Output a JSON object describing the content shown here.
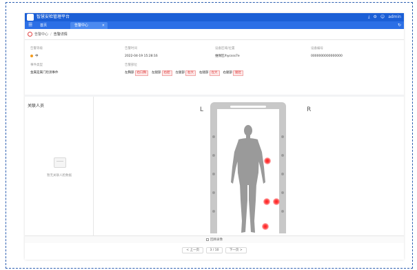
{
  "app": {
    "title": "智慧安检管理平台",
    "user": "admin"
  },
  "topbar": {
    "icons": [
      "download-icon",
      "settings-icon",
      "user-icon"
    ]
  },
  "tabs": [
    {
      "label": "首页"
    },
    {
      "label": "告警中心"
    }
  ],
  "breadcrumb": {
    "parent": "告警中心",
    "current": "告警详情"
  },
  "info": {
    "alarm_level": {
      "label": "告警等级",
      "value": "中"
    },
    "alarm_time": {
      "label": "告警时间",
      "value": "2022-04-19 15:28:16"
    },
    "device_location": {
      "label": "设备区域/位置",
      "value": "维保区/hycsss7e"
    },
    "device_id": {
      "label": "设备编号",
      "value": "0000000000000000"
    },
    "event_type": {
      "label": "事件类型",
      "value": "金属是属门检测事件"
    },
    "alarm_parts": {
      "label": "告警部位",
      "items": [
        {
          "part": "左胸部",
          "tag": "右口胸"
        },
        {
          "part": "左腿部",
          "tag": "右胫"
        },
        {
          "part": "左腿部",
          "tag": "右大"
        },
        {
          "part": "右腿部",
          "tag": "左大"
        },
        {
          "part": "右腿部",
          "tag": "腿肚"
        }
      ]
    }
  },
  "left_panel": {
    "title": "关联人员",
    "empty_text": "暂无关联人脸数据"
  },
  "viewer": {
    "left_mark": "L",
    "right_mark": "R"
  },
  "footer": {
    "label": "回顾录像"
  },
  "pager": {
    "prev": "< 上一页",
    "count": "3 / 10",
    "next": "下一页 >"
  },
  "colors": {
    "primary": "#1b5fd6",
    "alert": "#e04040",
    "level_mid": "#f29b1d"
  }
}
